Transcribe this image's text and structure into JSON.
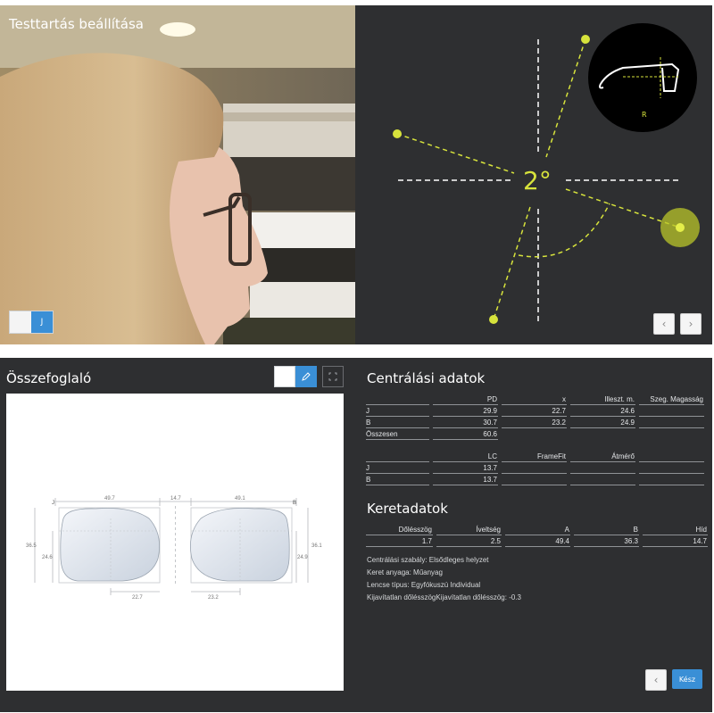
{
  "camera_panel": {
    "title": "Testtartás beállítása",
    "toggle_right_label": "J"
  },
  "angle_panel": {
    "angle_value": "2°",
    "side_label": "R",
    "accent_color": "#d7e33c",
    "prev_label": "‹",
    "next_label": "›"
  },
  "summary": {
    "title": "Összefoglaló",
    "drawing": {
      "left_label": "J",
      "right_label": "B",
      "bridge_width": "14.7",
      "left_width": "49.7",
      "right_width": "49.1",
      "left_height_outer": "36.5",
      "left_height_inner": "24.6",
      "right_height_outer": "36.1",
      "right_height_inner": "24.9",
      "left_pd": "22.7",
      "right_pd": "23.2"
    }
  },
  "centration": {
    "title": "Centrálási adatok",
    "table1": {
      "headers": [
        "",
        "PD",
        "x",
        "Illeszt. m.",
        "Szeg. Magasság"
      ],
      "rows": [
        [
          "J",
          "29.9",
          "22.7",
          "24.6",
          ""
        ],
        [
          "B",
          "30.7",
          "23.2",
          "24.9",
          ""
        ],
        [
          "Összesen",
          "60.6",
          "",
          "",
          ""
        ]
      ]
    },
    "table2": {
      "headers": [
        "",
        "LC",
        "FrameFit",
        "Átmérő",
        ""
      ],
      "rows": [
        [
          "J",
          "13.7",
          "",
          "",
          ""
        ],
        [
          "B",
          "13.7",
          "",
          "",
          ""
        ]
      ]
    }
  },
  "frame": {
    "title": "Keretadatok",
    "headers": [
      "Dőlésszög",
      "Íveltség",
      "A",
      "B",
      "Híd"
    ],
    "values": [
      "1.7",
      "2.5",
      "49.4",
      "36.3",
      "14.7"
    ],
    "info": [
      "Centrálási szabály: Elsődleges helyzet",
      "Keret anyaga: Műanyag",
      "Lencse típus: Egyfókuszú Individual",
      "Kijavítatlan dőlésszögKijavítatlan dőlésszög: -0.3"
    ],
    "back_label": "‹",
    "done_label": "Kész"
  }
}
